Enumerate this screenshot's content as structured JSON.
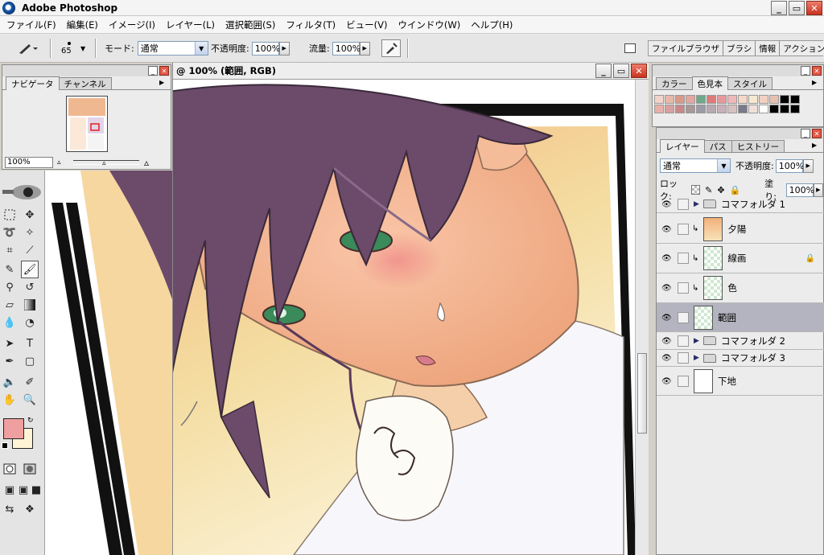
{
  "window": {
    "title": "Adobe Photoshop",
    "min_glyph": "_",
    "max_glyph": "▭",
    "close_glyph": "✕"
  },
  "menu": [
    "ファイル(F)",
    "編集(E)",
    "イメージ(I)",
    "レイヤー(L)",
    "選択範囲(S)",
    "フィルタ(T)",
    "ビュー(V)",
    "ウインドウ(W)",
    "ヘルプ(H)"
  ],
  "options": {
    "brush_size": "65",
    "mode_label": "モード:",
    "mode_value": "通常",
    "opacity_label": "不透明度:",
    "opacity_value": "100%",
    "flow_label": "流量:",
    "flow_value": "100%"
  },
  "palette_well": [
    "ファイルブラウザ",
    "ブラシ",
    "情報",
    "アクション"
  ],
  "navigator": {
    "tabs": [
      "ナビゲータ",
      "チャンネル"
    ],
    "zoom": "100%"
  },
  "document": {
    "title": "@ 100% (範囲, RGB)"
  },
  "swatches": {
    "tabs": [
      "カラー",
      "色見本",
      "スタイル"
    ],
    "colors": [
      "#f2d3c8",
      "#e8b8a8",
      "#d99a8a",
      "#e2a8a0",
      "#6fa88a",
      "#e07a7a",
      "#e89898",
      "#f0b8b8",
      "#f5d8c8",
      "#f8e8d0",
      "#f2d0c0",
      "#e6c0b0",
      "#000000",
      "#000000",
      "#e8b0a8",
      "#d8a0a0",
      "#c88888",
      "#a89898",
      "#9a9aa8",
      "#b8a8b0",
      "#c8b0b8",
      "#d8c0c0",
      "#7a7a8a",
      "#f2e0d8",
      "#ffffff",
      "#000000",
      "#000000",
      "#000000"
    ]
  },
  "layers": {
    "tabs": [
      "レイヤー",
      "パス",
      "ヒストリー"
    ],
    "blend_mode": "通常",
    "opacity_label": "不透明度:",
    "opacity_value": "100%",
    "lock_label": "ロック:",
    "fill_label": "塗り:",
    "fill_value": "100%",
    "items": [
      {
        "name": "コマフォルダ 1",
        "kind": "folder"
      },
      {
        "name": "夕陽",
        "kind": "layer"
      },
      {
        "name": "線画",
        "kind": "layer"
      },
      {
        "name": "色",
        "kind": "layer"
      },
      {
        "name": "範囲",
        "kind": "layer"
      },
      {
        "name": "コマフォルダ 2",
        "kind": "folder"
      },
      {
        "name": "コマフォルダ 3",
        "kind": "folder"
      },
      {
        "name": "下地",
        "kind": "layer"
      }
    ]
  },
  "colors": {
    "foreground": "#ef9fa0",
    "background": "#fff3d6"
  }
}
